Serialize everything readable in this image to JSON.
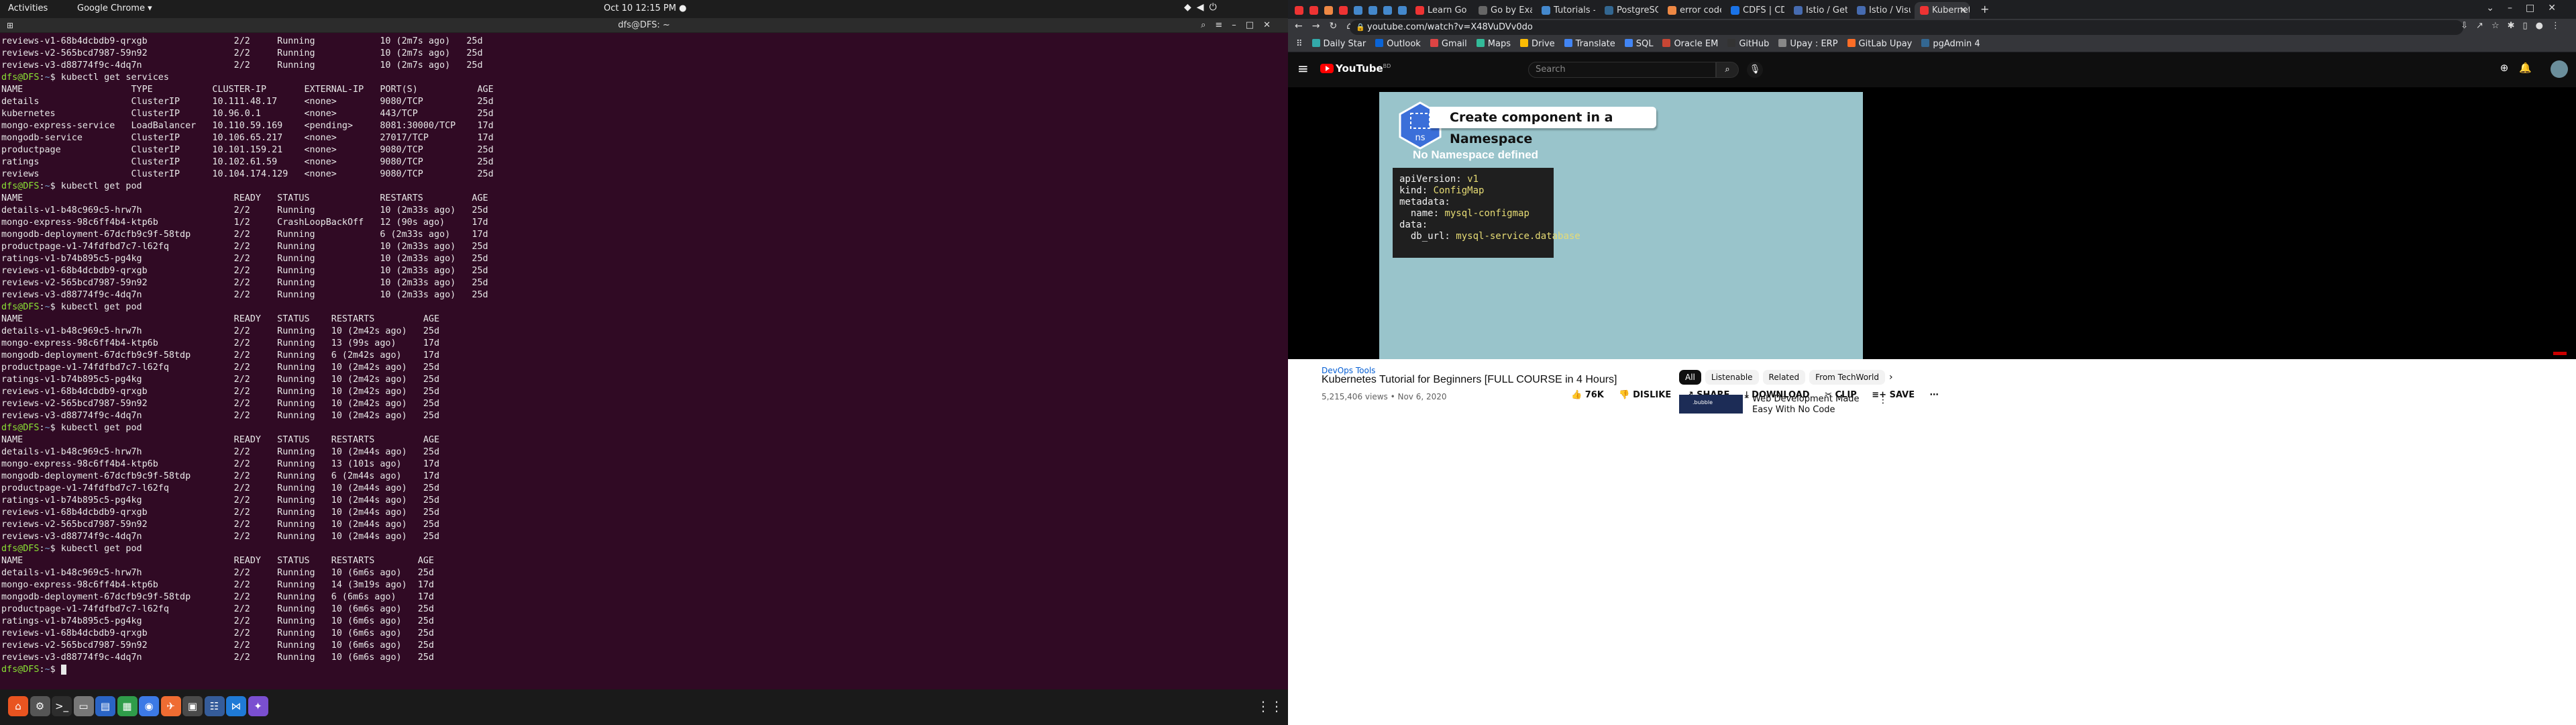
{
  "topbar": {
    "activities": "Activities",
    "app_menu": "Google Chrome ▾",
    "clock": "Oct 10  12:15 PM  ●"
  },
  "terminal": {
    "title": "dfs@DFS: ~",
    "lines": [
      {
        "t": "reviews-v1-68b4dcbdb9-qrxgb                2/2     Running            10 (2m7s ago)   25d"
      },
      {
        "t": "reviews-v2-565bcd7987-59n92                2/2     Running            10 (2m7s ago)   25d"
      },
      {
        "t": "reviews-v3-d88774f9c-4dq7n                 2/2     Running            10 (2m7s ago)   25d"
      },
      {
        "prompt": true,
        "cmd": "kubectl get services"
      },
      {
        "t": "NAME                    TYPE           CLUSTER-IP       EXTERNAL-IP   PORT(S)           AGE"
      },
      {
        "t": "details                 ClusterIP      10.111.48.17     <none>        9080/TCP          25d"
      },
      {
        "t": "kubernetes              ClusterIP      10.96.0.1        <none>        443/TCP           25d"
      },
      {
        "t": "mongo-express-service   LoadBalancer   10.110.59.169    <pending>     8081:30000/TCP    17d"
      },
      {
        "t": "mongodb-service         ClusterIP      10.106.65.217    <none>        27017/TCP         17d"
      },
      {
        "t": "productpage             ClusterIP      10.101.159.21    <none>        9080/TCP          25d"
      },
      {
        "t": "ratings                 ClusterIP      10.102.61.59     <none>        9080/TCP          25d"
      },
      {
        "t": "reviews                 ClusterIP      10.104.174.129   <none>        9080/TCP          25d"
      },
      {
        "prompt": true,
        "cmd": "kubectl get pod"
      },
      {
        "t": "NAME                                       READY   STATUS             RESTARTS         AGE"
      },
      {
        "t": "details-v1-b48c969c5-hrw7h                 2/2     Running            10 (2m33s ago)   25d"
      },
      {
        "t": "mongo-express-98c6ff4b4-ktp6b              1/2     CrashLoopBackOff   12 (90s ago)     17d"
      },
      {
        "t": "mongodb-deployment-67dcfb9c9f-58tdp        2/2     Running            6 (2m33s ago)    17d"
      },
      {
        "t": "productpage-v1-74fdfbd7c7-l62fq            2/2     Running            10 (2m33s ago)   25d"
      },
      {
        "t": "ratings-v1-b74b895c5-pg4kg                 2/2     Running            10 (2m33s ago)   25d"
      },
      {
        "t": "reviews-v1-68b4dcbdb9-qrxgb                2/2     Running            10 (2m33s ago)   25d"
      },
      {
        "t": "reviews-v2-565bcd7987-59n92                2/2     Running            10 (2m33s ago)   25d"
      },
      {
        "t": "reviews-v3-d88774f9c-4dq7n                 2/2     Running            10 (2m33s ago)   25d"
      },
      {
        "prompt": true,
        "cmd": "kubectl get pod"
      },
      {
        "t": "NAME                                       READY   STATUS    RESTARTS         AGE"
      },
      {
        "t": "details-v1-b48c969c5-hrw7h                 2/2     Running   10 (2m42s ago)   25d"
      },
      {
        "t": "mongo-express-98c6ff4b4-ktp6b              2/2     Running   13 (99s ago)     17d"
      },
      {
        "t": "mongodb-deployment-67dcfb9c9f-58tdp        2/2     Running   6 (2m42s ago)    17d"
      },
      {
        "t": "productpage-v1-74fdfbd7c7-l62fq            2/2     Running   10 (2m42s ago)   25d"
      },
      {
        "t": "ratings-v1-b74b895c5-pg4kg                 2/2     Running   10 (2m42s ago)   25d"
      },
      {
        "t": "reviews-v1-68b4dcbdb9-qrxgb                2/2     Running   10 (2m42s ago)   25d"
      },
      {
        "t": "reviews-v2-565bcd7987-59n92                2/2     Running   10 (2m42s ago)   25d"
      },
      {
        "t": "reviews-v3-d88774f9c-4dq7n                 2/2     Running   10 (2m42s ago)   25d"
      },
      {
        "prompt": true,
        "cmd": "kubectl get pod"
      },
      {
        "t": "NAME                                       READY   STATUS    RESTARTS         AGE"
      },
      {
        "t": "details-v1-b48c969c5-hrw7h                 2/2     Running   10 (2m44s ago)   25d"
      },
      {
        "t": "mongo-express-98c6ff4b4-ktp6b              2/2     Running   13 (101s ago)    17d"
      },
      {
        "t": "mongodb-deployment-67dcfb9c9f-58tdp        2/2     Running   6 (2m44s ago)    17d"
      },
      {
        "t": "productpage-v1-74fdfbd7c7-l62fq            2/2     Running   10 (2m44s ago)   25d"
      },
      {
        "t": "ratings-v1-b74b895c5-pg4kg                 2/2     Running   10 (2m44s ago)   25d"
      },
      {
        "t": "reviews-v1-68b4dcbdb9-qrxgb                2/2     Running   10 (2m44s ago)   25d"
      },
      {
        "t": "reviews-v2-565bcd7987-59n92                2/2     Running   10 (2m44s ago)   25d"
      },
      {
        "t": "reviews-v3-d88774f9c-4dq7n                 2/2     Running   10 (2m44s ago)   25d"
      },
      {
        "prompt": true,
        "cmd": "kubectl get pod"
      },
      {
        "t": "NAME                                       READY   STATUS    RESTARTS        AGE"
      },
      {
        "t": "details-v1-b48c969c5-hrw7h                 2/2     Running   10 (6m6s ago)   25d"
      },
      {
        "t": "mongo-express-98c6ff4b4-ktp6b              2/2     Running   14 (3m19s ago)  17d"
      },
      {
        "t": "mongodb-deployment-67dcfb9c9f-58tdp        2/2     Running   6 (6m6s ago)    17d"
      },
      {
        "t": "productpage-v1-74fdfbd7c7-l62fq            2/2     Running   10 (6m6s ago)   25d"
      },
      {
        "t": "ratings-v1-b74b895c5-pg4kg                 2/2     Running   10 (6m6s ago)   25d"
      },
      {
        "t": "reviews-v1-68b4dcbdb9-qrxgb                2/2     Running   10 (6m6s ago)   25d"
      },
      {
        "t": "reviews-v2-565bcd7987-59n92                2/2     Running   10 (6m6s ago)   25d"
      },
      {
        "t": "reviews-v3-d88774f9c-4dq7n                 2/2     Running   10 (6m6s ago)   25d"
      },
      {
        "prompt": true,
        "cmd": "",
        "cursor": true
      }
    ],
    "prompt_user": "dfs@DFS",
    "prompt_path": "~"
  },
  "dock": {
    "items": [
      {
        "name": "ubuntu-software-icon",
        "glyph": "⌂",
        "color": "#e95420"
      },
      {
        "name": "settings-icon",
        "glyph": "⚙",
        "color": "#555"
      },
      {
        "name": "terminal-icon",
        "glyph": ">_",
        "color": "#2d2d2d"
      },
      {
        "name": "files-icon",
        "glyph": "▭",
        "color": "#777"
      },
      {
        "name": "document-icon",
        "glyph": "▤",
        "color": "#2a64c5"
      },
      {
        "name": "spreadsheet-icon",
        "glyph": "▦",
        "color": "#2f9d4a"
      },
      {
        "name": "chrome-icon",
        "glyph": "◉",
        "color": "#3c7ae6"
      },
      {
        "name": "postman-icon",
        "glyph": "✈",
        "color": "#ef6c32"
      },
      {
        "name": "screenshot-icon",
        "glyph": "▣",
        "color": "#4a4a4a"
      },
      {
        "name": "database-icon",
        "glyph": "☷",
        "color": "#355c9a"
      },
      {
        "name": "vscode-icon",
        "glyph": "⋈",
        "color": "#1f7ad6"
      },
      {
        "name": "ide-icon",
        "glyph": "✦",
        "color": "#7a4fd0"
      }
    ],
    "apps_grid": "⋮⋮⋮"
  },
  "chrome": {
    "tabs": [
      {
        "label": "",
        "color": "#e33"
      },
      {
        "label": "",
        "color": "#e33"
      },
      {
        "label": "",
        "color": "#e84"
      },
      {
        "label": "",
        "color": "#e33"
      },
      {
        "label": "",
        "color": "#48c"
      },
      {
        "label": "",
        "color": "#48c"
      },
      {
        "label": "",
        "color": "#48c"
      },
      {
        "label": "",
        "color": "#48c"
      },
      {
        "label": "Learn Go Pro",
        "color": "#e33"
      },
      {
        "label": "Go by Examp",
        "color": "#666"
      },
      {
        "label": "Tutorials - Th",
        "color": "#48c"
      },
      {
        "label": "PostgreSQL",
        "color": "#336791"
      },
      {
        "label": "error code ai",
        "color": "#e84"
      },
      {
        "label": "CDFS | CDFS",
        "color": "#1a73e8"
      },
      {
        "label": "Istio / Gettin",
        "color": "#466bb0"
      },
      {
        "label": "Istio / Visual",
        "color": "#466bb0"
      },
      {
        "label": "Kubernetes",
        "color": "#e33",
        "active": true
      }
    ],
    "new_tab": "+",
    "url": "youtube.com/watch?v=X48VuDVv0do",
    "bookmarks": [
      {
        "label": "Daily Star",
        "color": "#3aa"
      },
      {
        "label": "Outlook",
        "color": "#0a64d6"
      },
      {
        "label": "Gmail",
        "color": "#d44"
      },
      {
        "label": "Maps",
        "color": "#3b9"
      },
      {
        "label": "Drive",
        "color": "#fbbc04"
      },
      {
        "label": "Translate",
        "color": "#4285f4"
      },
      {
        "label": "SQL",
        "color": "#4285f4"
      },
      {
        "label": "Oracle EM",
        "color": "#c74634"
      },
      {
        "label": "GitHub",
        "color": "#333"
      },
      {
        "label": "Upay : ERP",
        "color": "#888"
      },
      {
        "label": "GitLab Upay",
        "color": "#fc6d26"
      },
      {
        "label": "pgAdmin 4",
        "color": "#336791"
      }
    ]
  },
  "youtube": {
    "logo": "YouTube",
    "logo_region": "BD",
    "search_placeholder": "Search",
    "slide": {
      "badge": "ns",
      "banner": "Create component in a Namespace",
      "subtitle": "No Namespace defined",
      "code": [
        {
          "k": "apiVersion: ",
          "v": "v1"
        },
        {
          "k": "kind: ",
          "v": "ConfigMap"
        },
        {
          "k": "metadata:",
          "v": ""
        },
        {
          "k": "  name: ",
          "v": "mysql-configmap"
        },
        {
          "k": "data:",
          "v": ""
        },
        {
          "k": "  db_url: ",
          "v": "mysql-service.database"
        }
      ]
    },
    "channel": "DevOps Tools",
    "title": "Kubernetes Tutorial for Beginners [FULL COURSE in 4 Hours]",
    "meta": "5,215,406 views • Nov 6, 2020",
    "actions": {
      "like": "👍 76K",
      "dislike": "👎 DISLIKE",
      "share": "↗ SHARE",
      "download": "⤓ DOWNLOAD",
      "clip": "✂ CLIP",
      "save": "≡+ SAVE",
      "more": "⋯"
    },
    "chips": [
      "All",
      "Listenable",
      "Related",
      "From TechWorld"
    ],
    "recommended": {
      "thumb_text": ".bubble",
      "title": "Web Development Made Easy With No Code"
    }
  }
}
